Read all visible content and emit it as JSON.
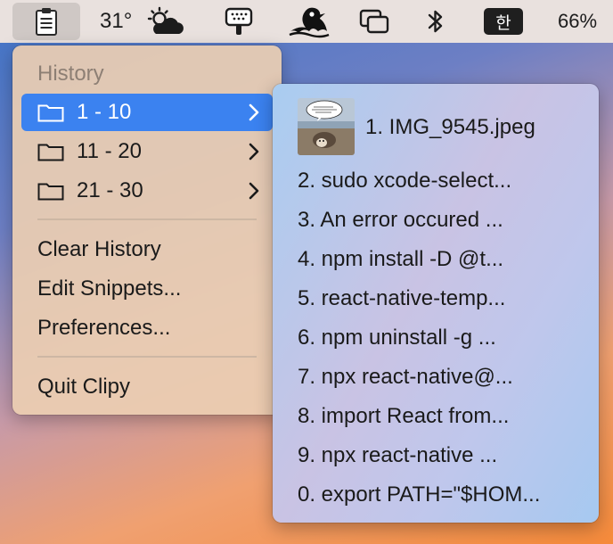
{
  "menubar": {
    "temperature": "31°",
    "input_method": "한",
    "battery": "66%"
  },
  "menu": {
    "header": "History",
    "groups": [
      {
        "label": "1 - 10"
      },
      {
        "label": "11 - 20"
      },
      {
        "label": "21 - 30"
      }
    ],
    "actions": {
      "clear": "Clear History",
      "snippets": "Edit Snippets...",
      "preferences": "Preferences...",
      "quit": "Quit Clipy"
    }
  },
  "submenu": {
    "items": [
      "1. IMG_9545.jpeg",
      "2. sudo xcode-select...",
      "3. An error occured ...",
      "4. npm install -D @t...",
      "5. react-native-temp...",
      "6. npm uninstall -g ...",
      "7. npx react-native@...",
      "8. import React from...",
      "9. npx react-native ...",
      "0. export PATH=\"$HOM..."
    ]
  },
  "colors": {
    "selection": "#3b82f0",
    "menu_bg": "#ecceb2",
    "submenu_bg": "#b9cbee"
  },
  "icons": {
    "menubar": [
      "clipboard-icon",
      "partly-cloudy-icon",
      "shower-icon",
      "creature-icon",
      "screen-mirroring-icon",
      "bluetooth-icon"
    ],
    "menu": [
      "folder-icon",
      "chevron-right-icon"
    ],
    "submenu": [
      "image-thumbnail"
    ]
  }
}
